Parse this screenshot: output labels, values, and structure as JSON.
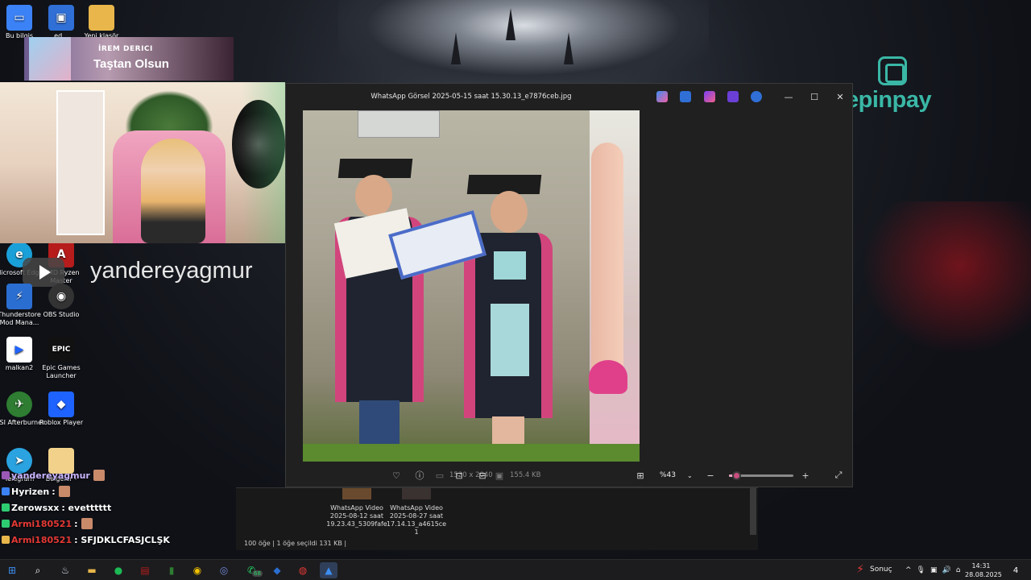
{
  "desktop": {
    "icons": [
      {
        "label": "Bu bilgis",
        "icon": "computer-icon",
        "color": "#3b82f6"
      },
      {
        "label": "ed...",
        "icon": "window-icon",
        "color": "#2f6fd6"
      },
      {
        "label": "Yeni klasör",
        "icon": "folder-icon",
        "color": "#e8b64a"
      },
      {
        "label": "Microsoft Edge",
        "icon": "edge-icon",
        "color": "#1aa0d8"
      },
      {
        "label": "AMD Ryzen Master",
        "icon": "amd-icon",
        "color": "#b71c1c"
      },
      {
        "label": "Thunderstore Mod Mana...",
        "icon": "thunderstore-icon",
        "color": "#2b6ed1"
      },
      {
        "label": "OBS Studio",
        "icon": "obs-icon",
        "color": "#333333"
      },
      {
        "label": "malkan2",
        "icon": "file-icon",
        "color": "#ffffff"
      },
      {
        "label": "Epic Games Launcher",
        "icon": "epic-games-icon",
        "color": "#111111"
      },
      {
        "label": "MSI Afterburner",
        "icon": "msi-afterburner-icon",
        "color": "#2e7d32"
      },
      {
        "label": "Roblox Player",
        "icon": "roblox-icon",
        "color": "#1e63ff"
      },
      {
        "label": "Telegram",
        "icon": "telegram-icon",
        "color": "#2aa3e0"
      },
      {
        "label": "Belgeler -",
        "icon": "documents-icon",
        "color": "#f2d28a"
      }
    ]
  },
  "stream": {
    "banner_name": "İREM DERICI",
    "banner_title": "Taştan Olsun",
    "channel_name": "yandereyagmur",
    "chat": [
      {
        "user": "yandereyagmur",
        "text": "",
        "color": "#c9b4ff"
      },
      {
        "user": "Hyrizen",
        "text": ":",
        "color": "#ffffff"
      },
      {
        "user": "Zerowsxx",
        "text": ": evetttttt",
        "color": "#ffffff"
      },
      {
        "user": "Armi180521",
        "text": ":",
        "color": "#e53935"
      },
      {
        "user": "Armi180521",
        "text": ": SFJDKLCFASJCLŞK",
        "color": "#e53935"
      }
    ]
  },
  "viewer": {
    "title": "WhatsApp Görsel 2025-05-15 saat 15.30.13_e7876ceb.jpg",
    "dimensions": "1530 x 2040",
    "file_size": "155.4 KB",
    "zoom": "%43",
    "zoom_fraction": 0.43,
    "app_icons": [
      "copilot-icon",
      "edit-icon",
      "clipchamp-icon",
      "designer-icon",
      "onedrive-icon"
    ]
  },
  "explorer": {
    "items": [
      {
        "label": "WhatsApp Video 2025-08-12 saat 19.23.43_5309fafe"
      },
      {
        "label": "WhatsApp Video 2025-08-27 saat 17.14.13_a4615ce 1"
      }
    ],
    "status": "100 öğe   |   1 öğe seçildi  131 KB   |"
  },
  "brand": {
    "name": "epinpay",
    "color": "#3ab7a6"
  },
  "taskbar": {
    "weather": "Sonuç",
    "time": "14:31",
    "date": "28.08.2025",
    "notifications": "4",
    "discord_badge": "68"
  }
}
